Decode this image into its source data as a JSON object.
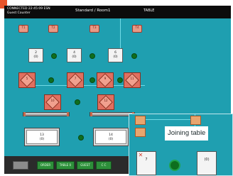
{
  "header": {
    "system_text": "CONNECTED  22:45:09  ESN\nGuest Counter",
    "view_title": "Standard / Room1",
    "table_label": "TABLE"
  },
  "floor": {
    "top_tiles": [
      {
        "label": "T1",
        "number": "1"
      },
      {
        "label": "T2",
        "number": "2"
      },
      {
        "label": "T3",
        "number": "3"
      },
      {
        "label": "T4",
        "number": "4"
      }
    ],
    "cards": [
      {
        "number": "2",
        "guests": "(0)"
      },
      {
        "number": "4",
        "guests": "(0)"
      },
      {
        "number": "6",
        "guests": "(0)"
      }
    ],
    "round_row_1": [
      {
        "label": "5",
        "sub": "(0)"
      },
      {
        "label": "7",
        "sub": "(0)"
      },
      {
        "label": "9",
        "sub": "(0)"
      },
      {
        "label": "11",
        "sub": "(0)"
      }
    ],
    "round_row_2": [
      {
        "label": "10",
        "sub": "(0)"
      },
      {
        "label": "12",
        "sub": "(0)"
      }
    ],
    "wide_tables": [
      {
        "number": "13",
        "guests": "(0)"
      },
      {
        "number": "14",
        "guests": "(0)"
      }
    ]
  },
  "footer": {
    "buttons": [
      {
        "label": "",
        "style": "gray"
      },
      {
        "label": "ORDER",
        "style": "green"
      },
      {
        "label": "TABLE 0",
        "style": "green"
      },
      {
        "label": "GUEST",
        "style": "green"
      },
      {
        "label": "C C",
        "style": "green"
      }
    ]
  },
  "callout": {
    "label": "Joining table",
    "card_number": "7",
    "card_guests": "(0)"
  },
  "colors": {
    "background": "#1f9fb0",
    "accent": "#e8542a",
    "green": "#0e6e1e"
  },
  "icons": {
    "seat": "green-dot-icon",
    "remove": "x-icon",
    "gear": "gear-icon"
  }
}
